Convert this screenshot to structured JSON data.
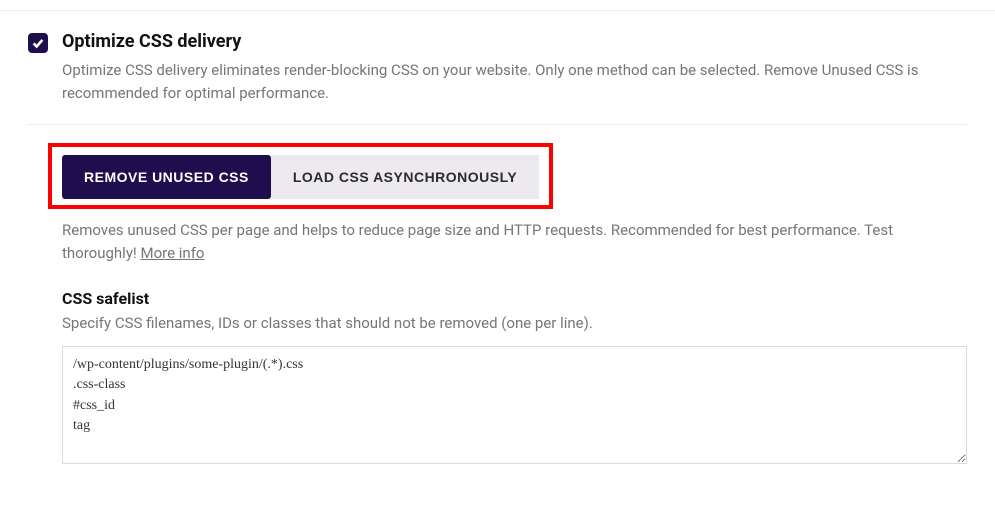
{
  "header": {
    "title": "Optimize CSS delivery",
    "description": "Optimize CSS delivery eliminates render-blocking CSS on your website. Only one method can be selected. Remove Unused CSS is recommended for optimal performance."
  },
  "tabs": {
    "remove_unused": "REMOVE UNUSED CSS",
    "load_async": "LOAD CSS ASYNCHRONOUSLY"
  },
  "sub": {
    "description_pre": "Removes unused CSS per page and helps to reduce page size and HTTP requests. Recommended for best performance. Test thoroughly! ",
    "more_info": "More info"
  },
  "safelist": {
    "title": "CSS safelist",
    "description": "Specify CSS filenames, IDs or classes that should not be removed (one per line).",
    "value": "/wp-content/plugins/some-plugin/(.*).css\n.css-class\n#css_id\ntag"
  }
}
